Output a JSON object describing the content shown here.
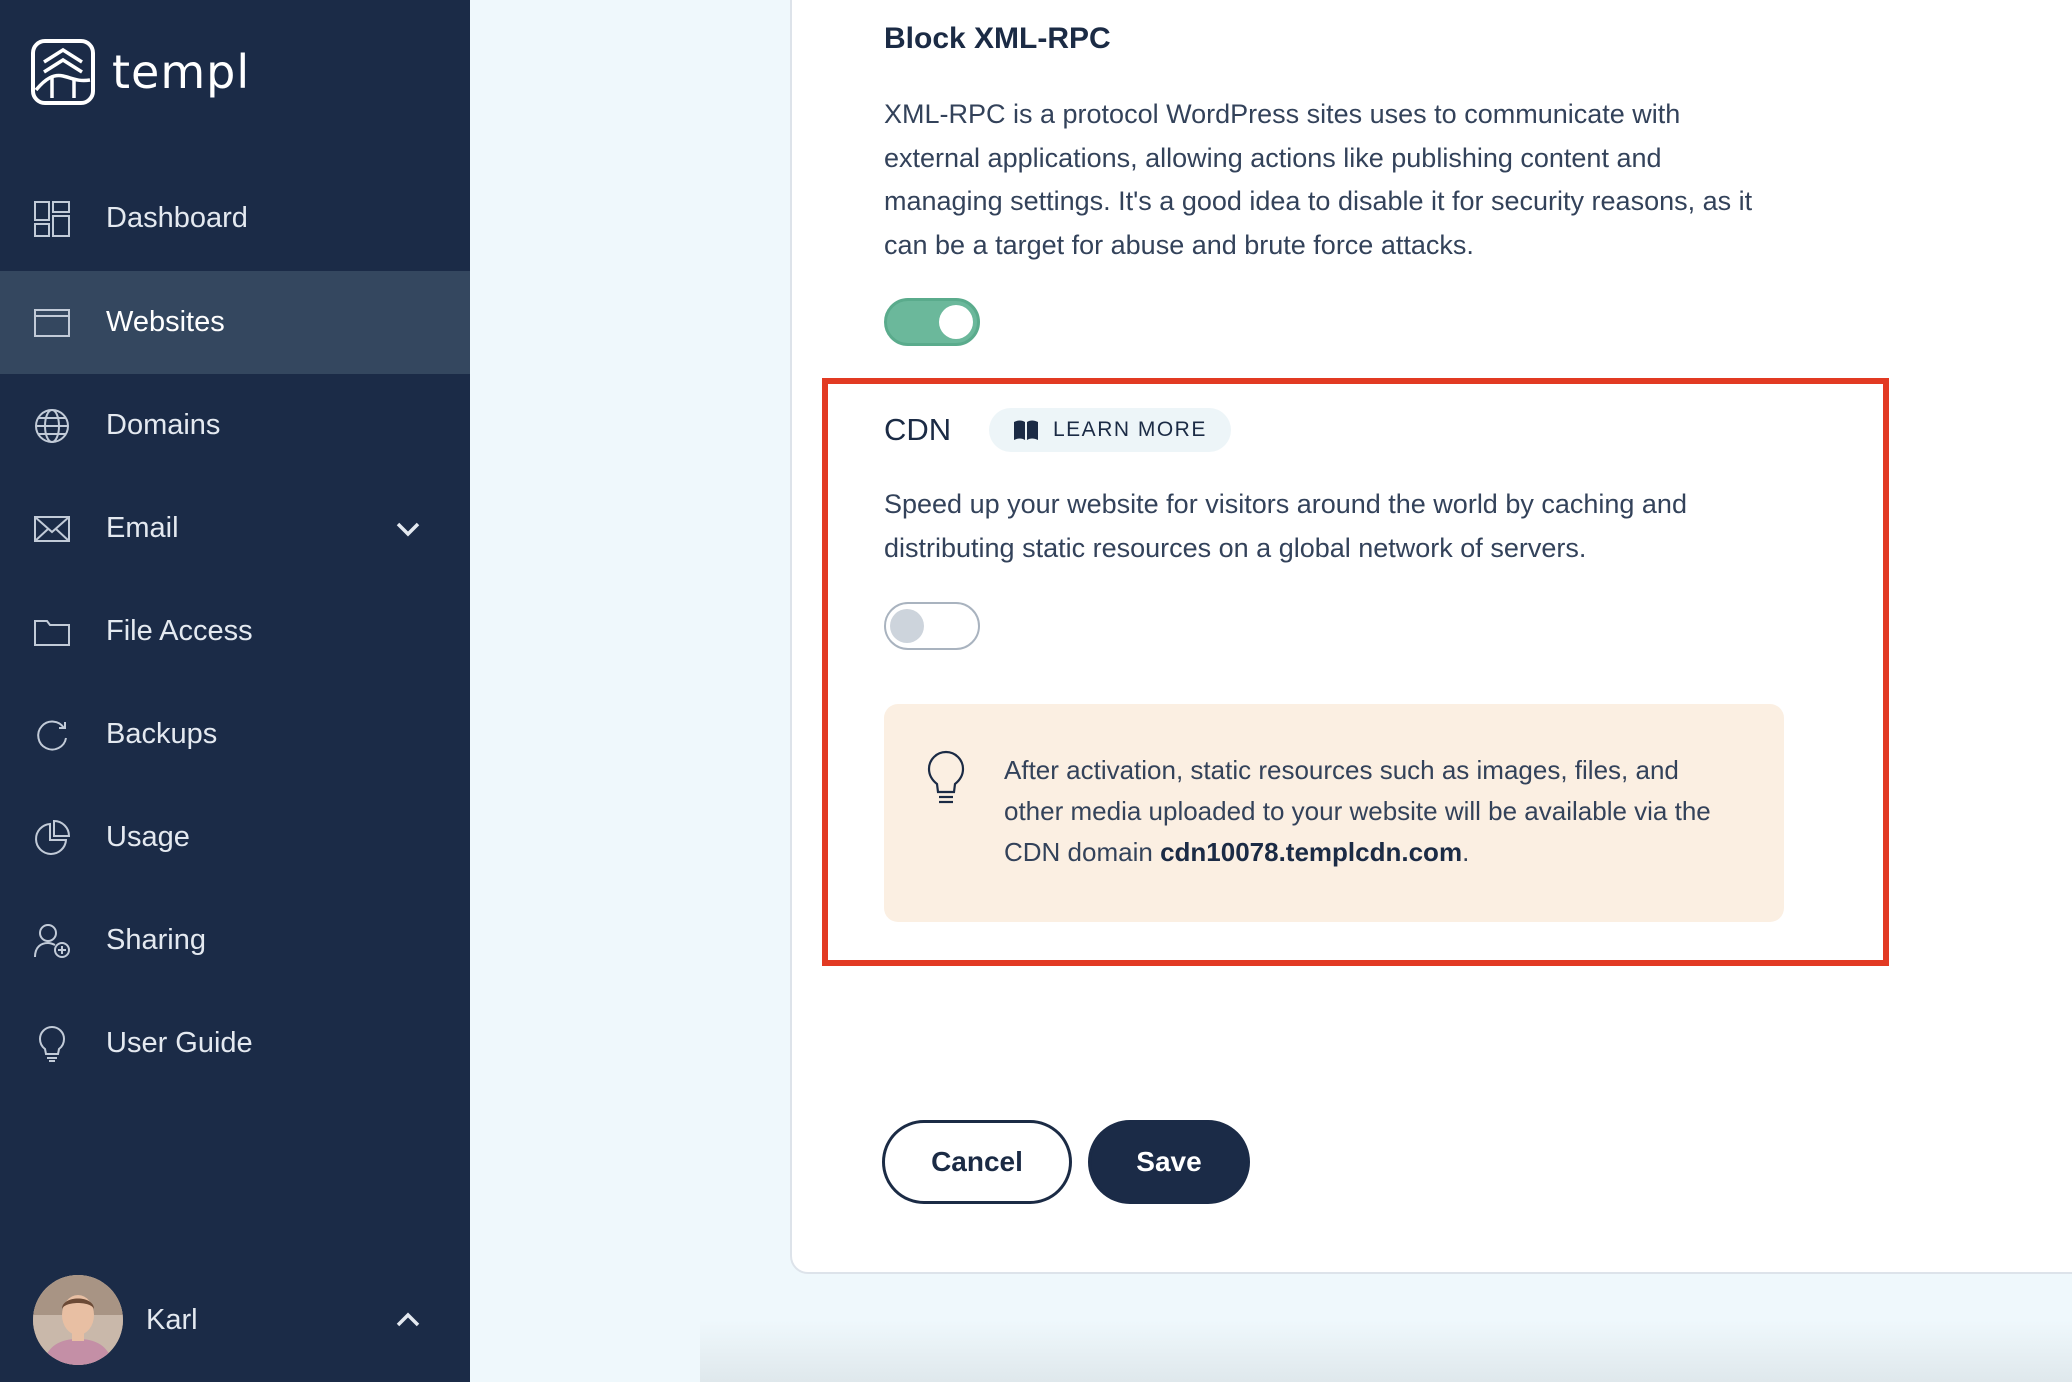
{
  "brand": {
    "name": "templ"
  },
  "sidebar": {
    "items": [
      {
        "label": "Dashboard",
        "icon": "dashboard-icon",
        "active": false
      },
      {
        "label": "Websites",
        "icon": "browser-window-icon",
        "active": true
      },
      {
        "label": "Domains",
        "icon": "globe-icon",
        "active": false
      },
      {
        "label": "Email",
        "icon": "envelope-icon",
        "active": false,
        "expandable": true
      },
      {
        "label": "File Access",
        "icon": "folder-icon",
        "active": false
      },
      {
        "label": "Backups",
        "icon": "refresh-icon",
        "active": false
      },
      {
        "label": "Usage",
        "icon": "pie-chart-icon",
        "active": false
      },
      {
        "label": "Sharing",
        "icon": "user-add-icon",
        "active": false
      },
      {
        "label": "User Guide",
        "icon": "lightbulb-icon",
        "active": false
      }
    ],
    "user": {
      "name": "Karl"
    }
  },
  "main": {
    "xmlrpc": {
      "title": "Block XML-RPC",
      "description": "XML-RPC is a protocol WordPress sites uses to communicate with external applications, allowing actions like publishing content and managing settings. It's a good idea to disable it for security reasons, as it can be a target for abuse and brute force attacks.",
      "enabled": true
    },
    "cdn": {
      "title": "CDN",
      "learn_more_label": "LEARN MORE",
      "description": "Speed up your website for visitors around the world by caching and distributing static resources on a global network of servers.",
      "enabled": false,
      "info": {
        "text_before": "After activation, static resources such as images, files, and other media uploaded to your website will be available via the CDN domain ",
        "domain": "cdn10078.templcdn.com",
        "text_after": "."
      }
    },
    "actions": {
      "cancel_label": "Cancel",
      "save_label": "Save"
    }
  },
  "colors": {
    "sidebar_bg": "#1b2b47",
    "sidebar_active_bg": "#34475f",
    "toggle_on": "#6bb89b",
    "highlight_border": "#e23a23",
    "info_bg": "#fbefe2",
    "page_bg": "#eff8fc"
  }
}
